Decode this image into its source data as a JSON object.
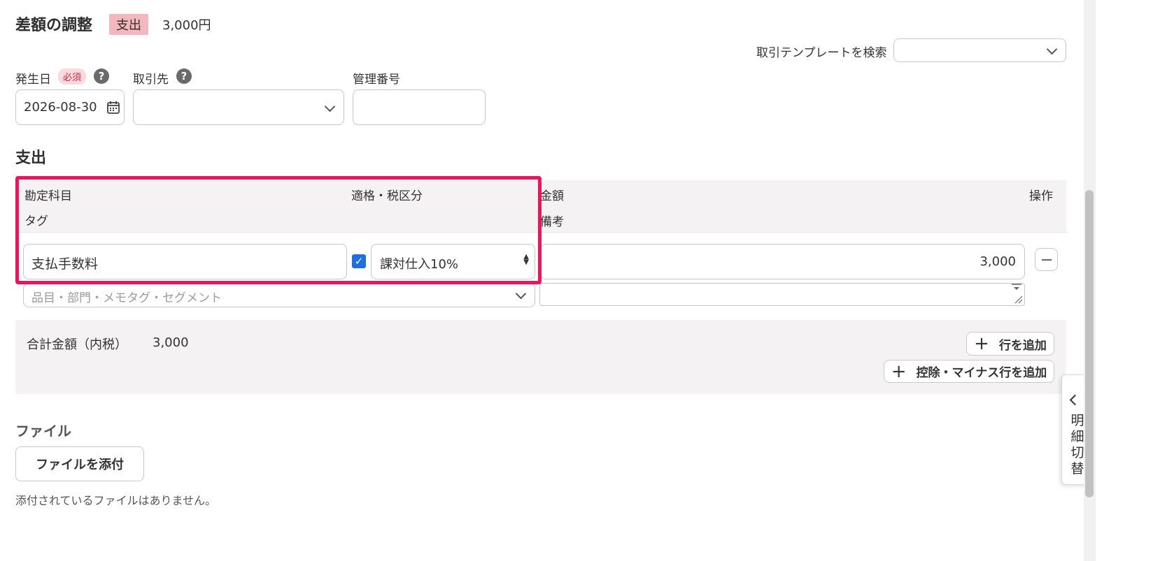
{
  "header": {
    "title": "差額の調整",
    "type_badge": "支出",
    "amount": "3,000円"
  },
  "template_search": {
    "label": "取引テンプレートを検索",
    "value": ""
  },
  "fields": {
    "date_label": "発生日",
    "required_badge": "必須",
    "date_value": "2026-08-30",
    "partner_label": "取引先",
    "partner_value": "",
    "mgmt_label": "管理番号",
    "mgmt_value": "",
    "help_glyph": "?"
  },
  "expense_section": {
    "title": "支出",
    "columns": {
      "account": "勘定科目",
      "tax": "適格・税区分",
      "amount": "金額",
      "actions": "操作",
      "tag": "タグ",
      "memo": "備考"
    },
    "row": {
      "account": "支払手数料",
      "qualified_checked": true,
      "tax_category": "課対仕入10%",
      "amount": "3,000",
      "tag_placeholder": "品目・部門・メモタグ・セグメント",
      "memo": ""
    },
    "total_label": "合計金額（内税）",
    "total_value": "3,000",
    "add_row_label": "行を追加",
    "add_deduction_label": "控除・マイナス行を追加"
  },
  "files": {
    "title": "ファイル",
    "attach_label": "ファイルを添付",
    "empty_message": "添付されているファイルはありません。"
  },
  "side_tab": {
    "label_chars": [
      "明",
      "細",
      "切",
      "替"
    ]
  },
  "colors": {
    "highlight": "#e8175d",
    "expense_badge": "#f3b8bf",
    "checkbox": "#1f6fe0"
  }
}
